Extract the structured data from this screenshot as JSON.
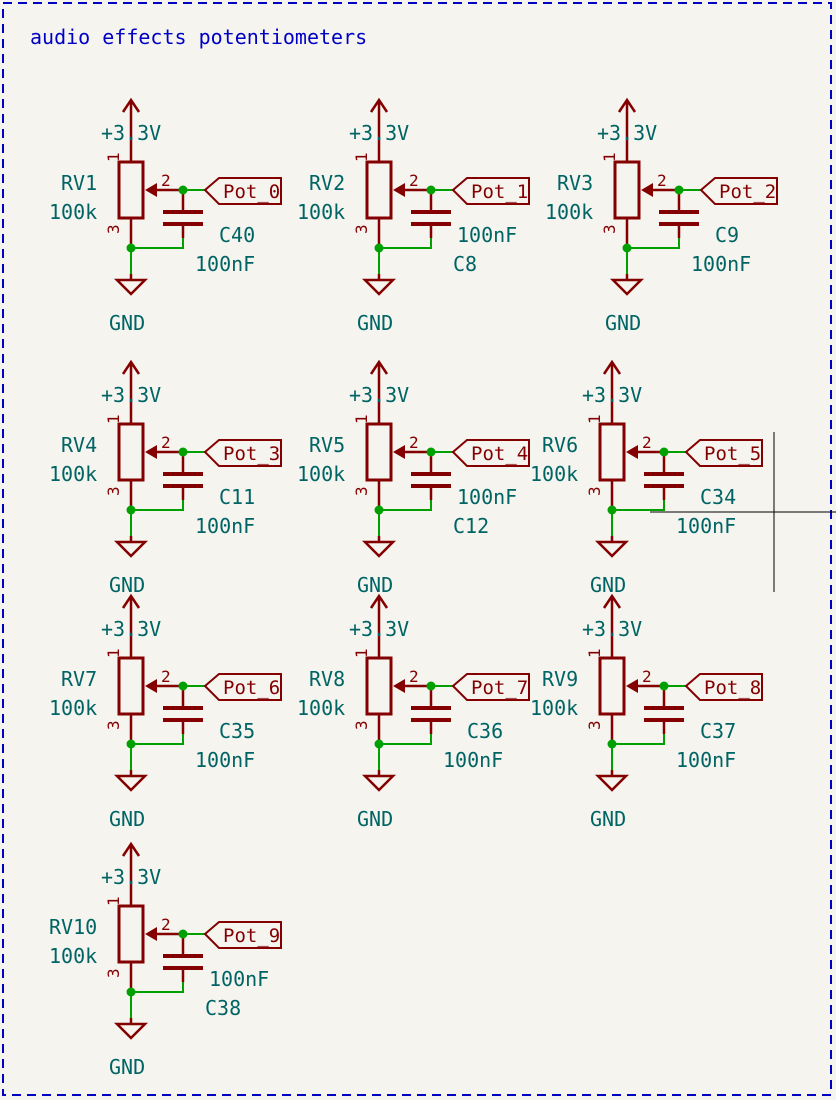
{
  "sheet_title": "audio effects potentiometers",
  "colors": {
    "wire": "#00a000",
    "symbol": "#840000",
    "text": "#006464",
    "border": "#0000c4",
    "background": "#f5f4ef",
    "junction": "#00a000"
  },
  "blocks": [
    {
      "ref": "RV1",
      "value": "100k",
      "power": "+3.3V",
      "gnd": "GND",
      "pin_wiper": "2",
      "pin_top": "1",
      "pin_bottom": "3",
      "label": "Pot_0",
      "cap_ref": "C40",
      "cap_value": "100nF"
    },
    {
      "ref": "RV2",
      "value": "100k",
      "power": "+3.3V",
      "gnd": "GND",
      "pin_wiper": "2",
      "pin_top": "1",
      "pin_bottom": "3",
      "label": "Pot_1",
      "cap_ref": "C8",
      "cap_value": "100nF"
    },
    {
      "ref": "RV3",
      "value": "100k",
      "power": "+3.3V",
      "gnd": "GND",
      "pin_wiper": "2",
      "pin_top": "1",
      "pin_bottom": "3",
      "label": "Pot_2",
      "cap_ref": "C9",
      "cap_value": "100nF"
    },
    {
      "ref": "RV4",
      "value": "100k",
      "power": "+3.3V",
      "gnd": "GND",
      "pin_wiper": "2",
      "pin_top": "1",
      "pin_bottom": "3",
      "label": "Pot_3",
      "cap_ref": "C11",
      "cap_value": "100nF"
    },
    {
      "ref": "RV5",
      "value": "100k",
      "power": "+3.3V",
      "gnd": "GND",
      "pin_wiper": "2",
      "pin_top": "1",
      "pin_bottom": "3",
      "label": "Pot_4",
      "cap_ref": "C12",
      "cap_value": "100nF"
    },
    {
      "ref": "RV6",
      "value": "100k",
      "power": "+3.3V",
      "gnd": "GND",
      "pin_wiper": "2",
      "pin_top": "1",
      "pin_bottom": "3",
      "label": "Pot_5",
      "cap_ref": "C34",
      "cap_value": "100nF"
    },
    {
      "ref": "RV7",
      "value": "100k",
      "power": "+3.3V",
      "gnd": "GND",
      "pin_wiper": "2",
      "pin_top": "1",
      "pin_bottom": "3",
      "label": "Pot_6",
      "cap_ref": "C35",
      "cap_value": "100nF"
    },
    {
      "ref": "RV8",
      "value": "100k",
      "power": "+3.3V",
      "gnd": "GND",
      "pin_wiper": "2",
      "pin_top": "1",
      "pin_bottom": "3",
      "label": "Pot_7",
      "cap_ref": "C36",
      "cap_value": "100nF"
    },
    {
      "ref": "RV9",
      "value": "100k",
      "power": "+3.3V",
      "gnd": "GND",
      "pin_wiper": "2",
      "pin_top": "1",
      "pin_bottom": "3",
      "label": "Pot_8",
      "cap_ref": "C37",
      "cap_value": "100nF"
    },
    {
      "ref": "RV10",
      "value": "100k",
      "power": "+3.3V",
      "gnd": "GND",
      "pin_wiper": "2",
      "pin_top": "1",
      "pin_bottom": "3",
      "label": "Pot_9",
      "cap_ref": "C38",
      "cap_value": "100nF"
    }
  ]
}
